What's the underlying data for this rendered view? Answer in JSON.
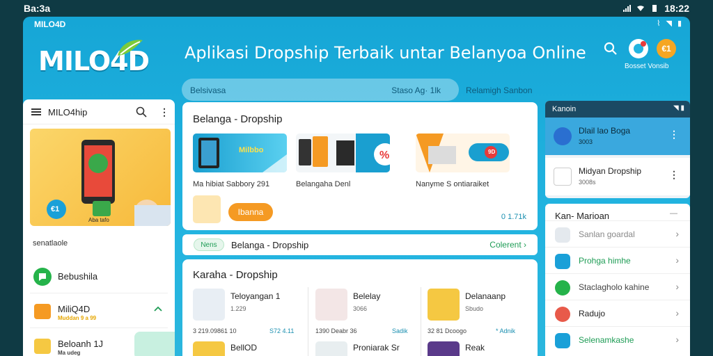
{
  "statusbar": {
    "time_left": "Ba:3a",
    "time_right": "18:22"
  },
  "window": {
    "title": "MILO4D"
  },
  "brand": {
    "logo": "MILO4D",
    "accent": "#22b4e0",
    "orange": "#f59a23",
    "green": "#1e9c55"
  },
  "header": {
    "headline": "Aplikasi Dropship Terbaik untar Belanyoa Online",
    "caption": "Bosset Vonsib",
    "badge": "€1"
  },
  "search": {
    "placeholder": "Belsivasa",
    "right_text": "Staso Ag· 1lk",
    "link": "Relamigh Sanbon"
  },
  "left_panel": {
    "title": "MILO4hip",
    "banner_caption": "Aba tafo",
    "banner_badge1": "€1",
    "row_text": "senatlaole",
    "items": [
      {
        "label": "Bebushila",
        "sub": ""
      },
      {
        "label": "MiliQ4D",
        "sub": "Muddan 9 a 99"
      },
      {
        "label": "Beloanh 1J",
        "sub": "Ma udeg"
      }
    ]
  },
  "center": {
    "section1_title": "Belanga - Dropship",
    "tiles": [
      {
        "caption": "Ma hibiat Sabbory 291",
        "label": "Milbbo"
      },
      {
        "caption": "Belangaha Denl",
        "label": ""
      },
      {
        "caption": "Nanyme S ontiaraiket",
        "label": "9D"
      }
    ],
    "button": "Ibanna",
    "stat": "0 1.71k",
    "strip": {
      "tag": "Nens",
      "text": "Belanga - Dropship",
      "link": "Colerent"
    },
    "section2_title": "Karaha - Dropship",
    "products": [
      {
        "name": "Teloyangan 1",
        "rate": "1.229",
        "meta": "3 219.09861 10",
        "meta2": "S72 4.11",
        "name2": "BellOD"
      },
      {
        "name": "Belelay",
        "rate": "3066",
        "meta": "1390 Deabr 36",
        "meta2": "Sadik",
        "name2": "Proniarak Sr"
      },
      {
        "name": "Delanaanp",
        "rate": "Sbudo",
        "meta": "32 81 Dcoogo",
        "meta2": "* Adnik",
        "name2": "Reak"
      }
    ]
  },
  "right_panel": {
    "header": "Kanoin",
    "items": [
      {
        "name": "Dlail lao Boga",
        "sub": "3003"
      },
      {
        "name": "Midyan Dropship",
        "sub": "3008s"
      }
    ],
    "section_title": "Kan- Marioan",
    "section_link": "—",
    "list": [
      {
        "label": "Sanlan goardal"
      },
      {
        "label": "Prohga himhe"
      },
      {
        "label": "Staclagholo kahine"
      },
      {
        "label": "Radujo"
      },
      {
        "label": "Selenamkashe"
      }
    ]
  }
}
